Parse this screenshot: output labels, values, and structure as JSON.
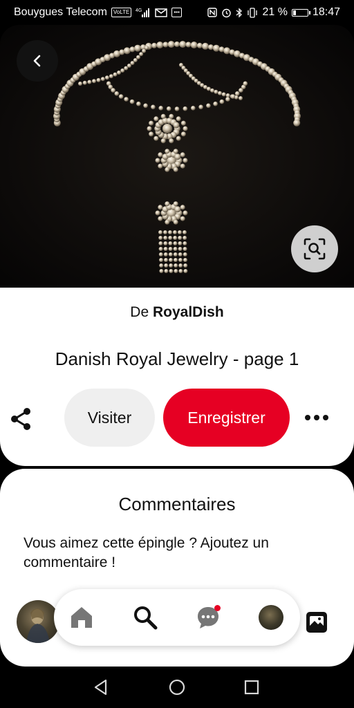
{
  "status_bar": {
    "carrier": "Bouygues Telecom",
    "volte": "VoLTE",
    "network": "4G",
    "battery_percent": "21 %",
    "battery_level": 0.21,
    "time": "18:47"
  },
  "pin": {
    "source_prefix": "De",
    "source_name": "RoyalDish",
    "title": "Danish Royal Jewelry - page 1"
  },
  "actions": {
    "visit_label": "Visiter",
    "save_label": "Enregistrer"
  },
  "comments": {
    "title": "Commentaires",
    "prompt": "Vous aimez cette épingle ? Ajoutez un commentaire !"
  },
  "nav": {
    "items": [
      "home-icon",
      "search-icon",
      "messages-icon",
      "profile-avatar"
    ],
    "has_message_notification": true
  },
  "colors": {
    "brand_red": "#e60023",
    "visit_bg": "#efefef"
  }
}
